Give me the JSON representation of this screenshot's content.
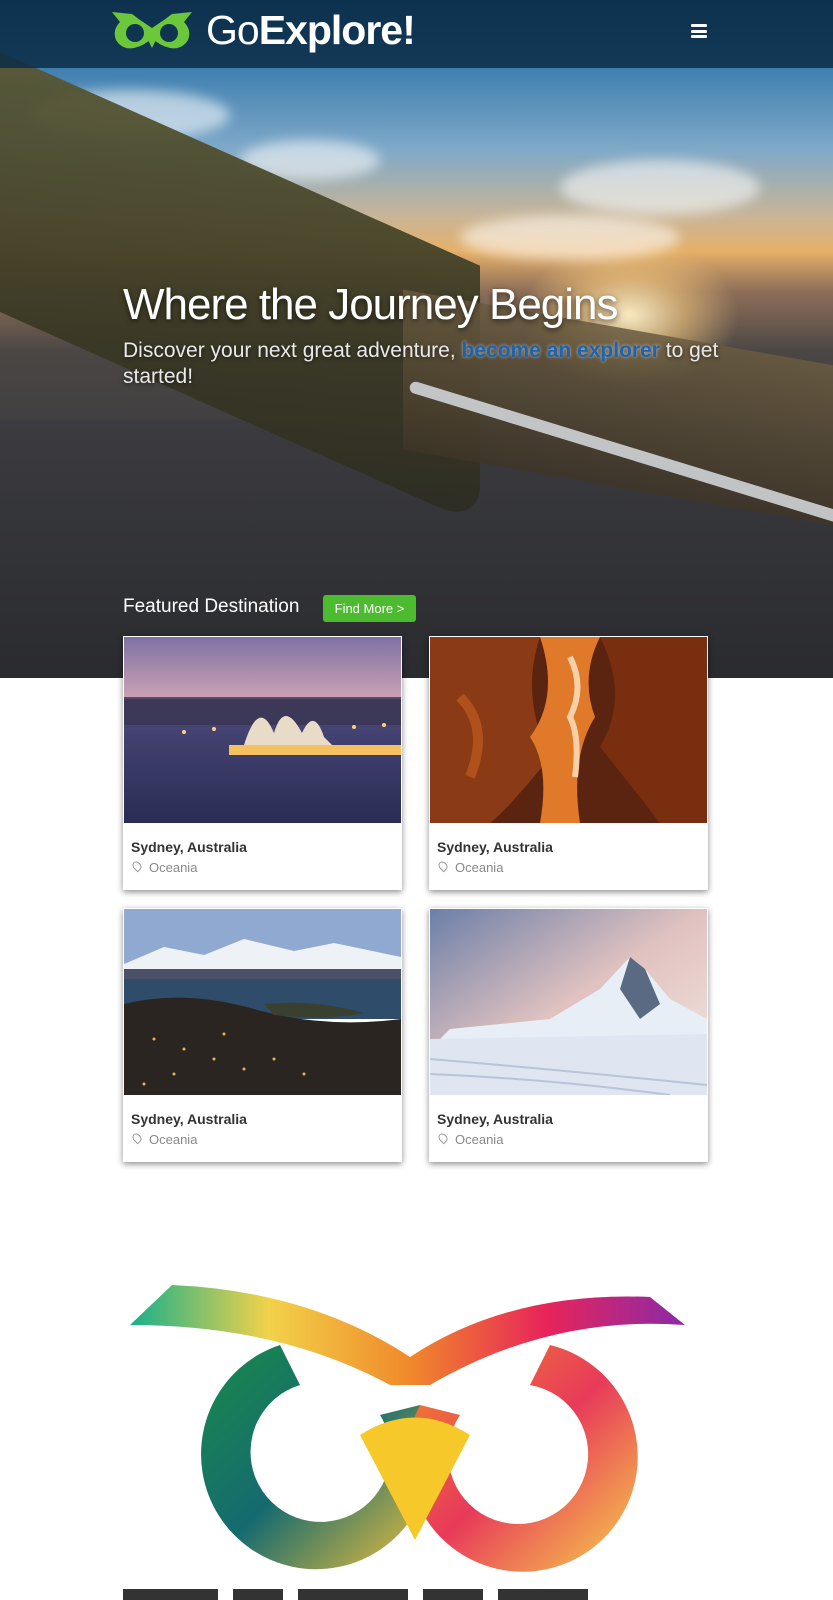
{
  "brand": {
    "name_prefix": "Go",
    "name_suffix": "Explore!",
    "accent": "#6cc73a"
  },
  "nav": {
    "menu_icon": "hamburger-menu-icon"
  },
  "hero": {
    "headline": "Where the Journey Begins",
    "subline_before": "Discover your next great adventure, ",
    "subline_link": "become an explorer",
    "subline_after": " to get started!"
  },
  "featured": {
    "heading": "Featured Destination",
    "button_label": "Find More >",
    "button_color": "#4dbb2f",
    "cards": [
      {
        "title": "Sydney, Australia",
        "region": "Oceania",
        "image": "sydney-opera-house-photo"
      },
      {
        "title": "Sydney, Australia",
        "region": "Oceania",
        "image": "slot-canyon-photo"
      },
      {
        "title": "Sydney, Australia",
        "region": "Oceania",
        "image": "lakeside-town-mountains-photo"
      },
      {
        "title": "Sydney, Australia",
        "region": "Oceania",
        "image": "snowy-mountain-peak-photo"
      }
    ]
  }
}
